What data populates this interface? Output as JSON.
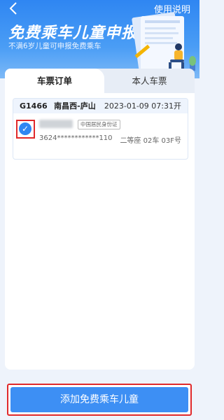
{
  "header": {
    "help_label": "使用说明",
    "title": "免费乘车儿童申报",
    "subtitle": "不满6岁儿童可申报免费乘车"
  },
  "tabs": [
    {
      "label": "车票订单",
      "active": true
    },
    {
      "label": "本人车票",
      "active": false
    }
  ],
  "order": {
    "train": "G1466",
    "route": "南昌西-庐山",
    "departure": "2023-01-09 07:31开",
    "passenger": {
      "id_type": "中国居民身份证",
      "id_number": "3624************110",
      "seat": "二等座 02车 03F号",
      "selected": true
    }
  },
  "footer": {
    "add_button_label": "添加免费乘车儿童"
  },
  "colors": {
    "primary": "#2f86f2",
    "highlight": "#e0292b"
  }
}
